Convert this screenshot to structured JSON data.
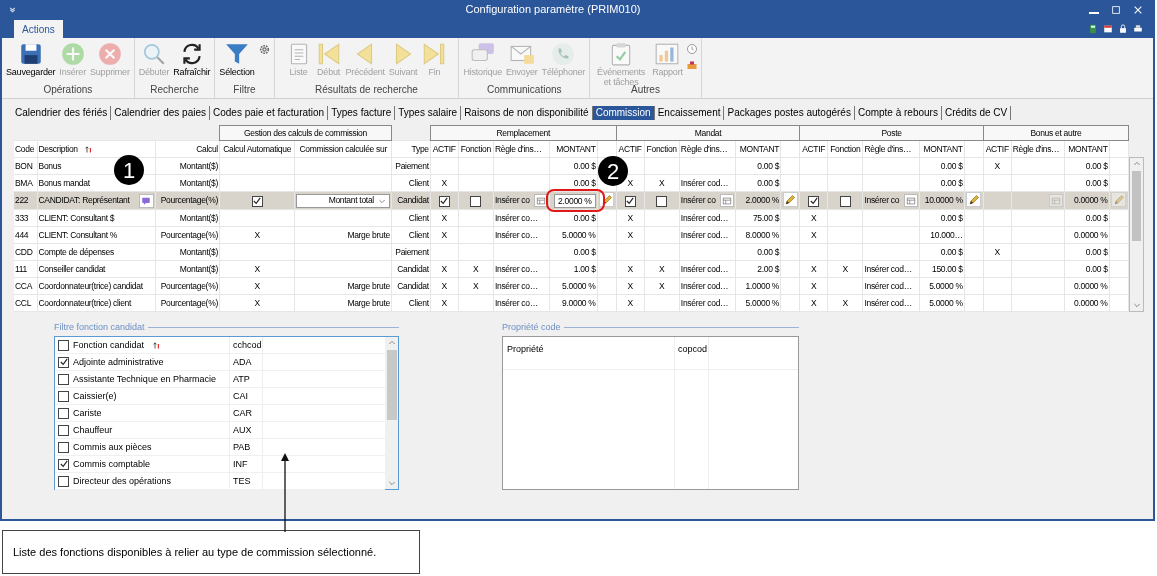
{
  "window": {
    "title": "Configuration paramètre (PRIM010)"
  },
  "ribbon_tabs": [
    {
      "label": "Actions",
      "selected": true
    }
  ],
  "ribbon_groups": [
    {
      "label": "Opérations",
      "buttons": [
        {
          "label": "Sauvegarder",
          "disabled": false
        },
        {
          "label": "Insérer",
          "disabled": true
        },
        {
          "label": "Supprimer",
          "disabled": true
        }
      ]
    },
    {
      "label": "Recherche",
      "buttons": [
        {
          "label": "Débuter",
          "disabled": true
        },
        {
          "label": "Rafraîchir",
          "disabled": false
        }
      ]
    },
    {
      "label": "Filtre",
      "buttons": [
        {
          "label": "Sélection",
          "disabled": false
        }
      ]
    },
    {
      "label": "Résultats de recherche",
      "buttons": [
        {
          "label": "Liste",
          "disabled": true
        },
        {
          "label": "Début",
          "disabled": true
        },
        {
          "label": "Précédent",
          "disabled": true
        },
        {
          "label": "Suivant",
          "disabled": true
        },
        {
          "label": "Fin",
          "disabled": true
        }
      ]
    },
    {
      "label": "Communications",
      "buttons": [
        {
          "label": "Historique",
          "disabled": true
        },
        {
          "label": "Envoyer",
          "disabled": true
        },
        {
          "label": "Téléphoner",
          "disabled": true
        }
      ]
    },
    {
      "label": "Autres",
      "buttons": [
        {
          "label": "Événements et tâches",
          "disabled": true
        },
        {
          "label": "Rapport",
          "disabled": true
        }
      ]
    }
  ],
  "tabs": [
    {
      "label": "Calendrier des fériés",
      "selected": false
    },
    {
      "label": "Calendrier des paies",
      "selected": false
    },
    {
      "label": "Codes paie et facturation",
      "selected": false
    },
    {
      "label": "Types facture",
      "selected": false
    },
    {
      "label": "Types salaire",
      "selected": false
    },
    {
      "label": "Raisons de non disponibilité",
      "selected": false
    },
    {
      "label": "Commission",
      "selected": true
    },
    {
      "label": "Encaissement",
      "selected": false
    },
    {
      "label": "Packages postes autogérés",
      "selected": false
    },
    {
      "label": "Compte à rebours",
      "selected": false
    },
    {
      "label": "Crédits de CV",
      "selected": false
    }
  ],
  "column_groups": [
    "Gestion des calculs de commission",
    "Remplacement",
    "Mandat",
    "Poste",
    "Bonus et autre"
  ],
  "columns": [
    "Code",
    "Description",
    "Calcul",
    "Calcul Automatique",
    "Commission calculée sur",
    "Type",
    "ACTIF",
    "Fonction",
    "Règle d'ins…",
    "MONTANT",
    "ACTIF",
    "Fonction",
    "Règle d'ins…",
    "MONTANT",
    "ACTIF",
    "Fonction",
    "Règle d'ins…",
    "MONTANT",
    "ACTIF",
    "Règle d'ins…",
    "MONTANT"
  ],
  "rows": [
    {
      "code": "BON",
      "description": "Bonus",
      "calcul": "Montant($)",
      "type": "Paiement",
      "selected": false,
      "remplacement": {
        "montant": "0.00 $"
      },
      "mandat": {
        "montant": "0.00 $"
      },
      "poste": {
        "montant": "0.00 $"
      },
      "bonus": {
        "actif": "X",
        "montant": "0.00 $"
      }
    },
    {
      "code": "BMA",
      "description": "Bonus mandat",
      "calcul": "Montant($)",
      "type": "Client",
      "selected": false,
      "remplacement": {
        "actif": "X",
        "montant": "0.00 $"
      },
      "mandat": {
        "actif": "X",
        "fonction": "X",
        "regle": "Insérer cod…",
        "montant": "0.00 $"
      },
      "poste": {
        "montant": "0.00 $"
      },
      "bonus": {
        "montant": "0.00 $"
      }
    },
    {
      "code": "222",
      "description": "CANDIDAT: Représentant",
      "calcul": "Pourcentage(%)",
      "auto": true,
      "base": "Montant total",
      "type": "Candidat",
      "selected": true,
      "remplacement": {
        "actif": true,
        "fonction": false,
        "regle": "Insérer co",
        "montant": "2.0000 %",
        "focused": true,
        "highlighted": true
      },
      "mandat": {
        "actif": true,
        "fonction": false,
        "regle": "Insérer co",
        "montant": "2.0000 %"
      },
      "poste": {
        "actif": true,
        "fonction": false,
        "regle": "Insérer co",
        "montant": "10.0000 %"
      },
      "bonus": {
        "montant": "0.0000 %",
        "disabled": true
      }
    },
    {
      "code": "333",
      "description": "CLIENT: Consultant $",
      "calcul": "Montant($)",
      "type": "Client",
      "selected": false,
      "remplacement": {
        "actif": "X",
        "regle": "Insérer co…",
        "montant": "0.00 $"
      },
      "mandat": {
        "actif": "X",
        "regle": "Insérer cod…",
        "montant": "75.00 $"
      },
      "poste": {
        "actif": "X",
        "montant": "0.00 $"
      },
      "bonus": {
        "montant": "0.00 $"
      }
    },
    {
      "code": "444",
      "description": "CLIENT: Consultant %",
      "calcul": "Pourcentage(%)",
      "auto": "X",
      "base": "Marge brute",
      "type": "Client",
      "selected": false,
      "remplacement": {
        "actif": "X",
        "regle": "Insérer co…",
        "montant": "5.0000 %"
      },
      "mandat": {
        "actif": "X",
        "regle": "Insérer cod…",
        "montant": "8.0000 %"
      },
      "poste": {
        "actif": "X",
        "montant": "10.000…"
      },
      "bonus": {
        "montant": "0.0000 %"
      }
    },
    {
      "code": "CDD",
      "description": "Compte de dépenses",
      "calcul": "Montant($)",
      "type": "Paiement",
      "selected": false,
      "remplacement": {
        "montant": "0.00 $"
      },
      "mandat": {
        "montant": "0.00 $"
      },
      "poste": {
        "montant": "0.00 $"
      },
      "bonus": {
        "actif": "X",
        "montant": "0.00 $"
      }
    },
    {
      "code": "111",
      "description": "Conseiller candidat",
      "calcul": "Montant($)",
      "auto": "X",
      "type": "Candidat",
      "selected": false,
      "remplacement": {
        "actif": "X",
        "fonction": "X",
        "regle": "Insérer co…",
        "montant": "1.00 $"
      },
      "mandat": {
        "actif": "X",
        "fonction": "X",
        "regle": "Insérer cod…",
        "montant": "2.00 $"
      },
      "poste": {
        "actif": "X",
        "fonction": "X",
        "regle": "Insérer cod…",
        "montant": "150.00 $"
      },
      "bonus": {
        "montant": "0.00 $"
      }
    },
    {
      "code": "CCA",
      "description": "Coordonnateur(trice) candidat",
      "calcul": "Pourcentage(%)",
      "auto": "X",
      "base": "Marge brute",
      "type": "Candidat",
      "selected": false,
      "remplacement": {
        "actif": "X",
        "fonction": "X",
        "regle": "Insérer co…",
        "montant": "5.0000 %"
      },
      "mandat": {
        "actif": "X",
        "fonction": "X",
        "regle": "Insérer cod…",
        "montant": "1.0000 %"
      },
      "poste": {
        "actif": "X",
        "regle": "Insérer cod…",
        "montant": "5.0000 %"
      },
      "bonus": {
        "montant": "0.0000 %"
      }
    },
    {
      "code": "CCL",
      "description": "Coordonnateur(trice) client",
      "calcul": "Pourcentage(%)",
      "auto": "X",
      "base": "Marge brute",
      "type": "Client",
      "selected": false,
      "remplacement": {
        "actif": "X",
        "regle": "Insérer co…",
        "montant": "9.0000 %"
      },
      "mandat": {
        "actif": "X",
        "regle": "Insérer cod…",
        "montant": "5.0000 %"
      },
      "poste": {
        "actif": "X",
        "fonction": "X",
        "regle": "Insérer cod…",
        "montant": "5.0000 %"
      },
      "bonus": {
        "montant": "0.0000 %"
      }
    }
  ],
  "callouts": [
    "1",
    "2"
  ],
  "filter_panel": {
    "title": "Filtre fonction candidat",
    "header": {
      "label": "Fonction candidat",
      "code": "cchcod",
      "checked": false
    },
    "items": [
      {
        "label": "Adjointe administrative",
        "code": "ADA",
        "checked": true
      },
      {
        "label": "Assistante Technique en Pharmacie",
        "code": "ATP",
        "checked": false
      },
      {
        "label": "Caissier(e)",
        "code": "CAI",
        "checked": false
      },
      {
        "label": "Cariste",
        "code": "CAR",
        "checked": false
      },
      {
        "label": "Chauffeur",
        "code": "AUX",
        "checked": false
      },
      {
        "label": "Commis aux pièces",
        "code": "PAB",
        "checked": false
      },
      {
        "label": "Commis comptable",
        "code": "INF",
        "checked": true
      },
      {
        "label": "Directeur des opérations",
        "code": "TES",
        "checked": false
      }
    ]
  },
  "property_panel": {
    "title": "Propriété code",
    "columns": [
      "Propriété",
      "copcod"
    ]
  },
  "note": "Liste des fonctions disponibles à relier au type de commission sélectionné."
}
